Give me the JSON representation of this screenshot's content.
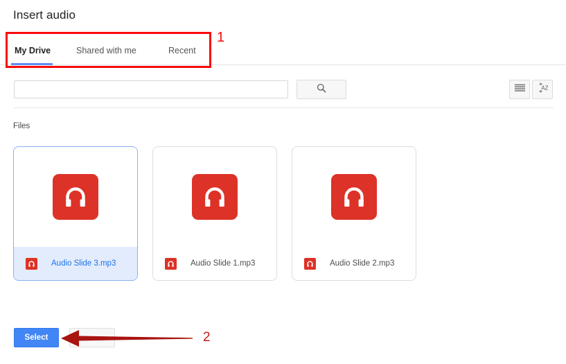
{
  "dialog": {
    "title": "Insert audio"
  },
  "tabs": [
    {
      "id": "my-drive",
      "label": "My Drive",
      "active": true
    },
    {
      "id": "shared",
      "label": "Shared with me",
      "active": false
    },
    {
      "id": "recent",
      "label": "Recent",
      "active": false
    }
  ],
  "search": {
    "value": "",
    "placeholder": "",
    "button_icon": "search-icon"
  },
  "toolbar": {
    "view_toggle_icon": "list-view-icon",
    "sort_icon": "sort-az-icon"
  },
  "files_section": {
    "label": "Files",
    "items": [
      {
        "name": "Audio Slide 3.mp3",
        "selected": true,
        "icon": "audio-file-icon"
      },
      {
        "name": "Audio Slide 1.mp3",
        "selected": false,
        "icon": "audio-file-icon"
      },
      {
        "name": "Audio Slide 2.mp3",
        "selected": false,
        "icon": "audio-file-icon"
      }
    ]
  },
  "footer": {
    "select_label": "Select",
    "cancel_label": ""
  },
  "annotations": {
    "num1": "1",
    "num2": "2"
  },
  "colors": {
    "accent_blue": "#4285f4",
    "tab_underline": "#5a8ef0",
    "selected_card_bg": "#e3ecfd",
    "selected_text": "#1a73e8",
    "audio_icon_red": "#dd3228",
    "annotation_red": "#fa0a0a",
    "arrow_red": "#a81410"
  }
}
